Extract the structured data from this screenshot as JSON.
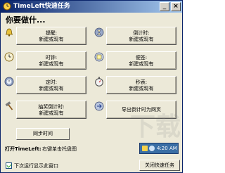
{
  "window": {
    "title": "TimeLeft快速任务",
    "minimize_label": "_",
    "close_label": "×"
  },
  "question": "你要做什...",
  "tasks": [
    {
      "line1": "提醒:",
      "line2": "新建或现有",
      "icon": "bell-icon"
    },
    {
      "line1": "倒计时:",
      "line2": "新建或现有",
      "icon": "hourglass-icon"
    },
    {
      "line1": "时钟:",
      "line2": "新建或现有",
      "icon": "clock-icon"
    },
    {
      "line1": "便签:",
      "line2": "新建或现有",
      "icon": "sticky-note-icon"
    },
    {
      "line1": "定时:",
      "line2": "新建或现有",
      "icon": "timer-icon"
    },
    {
      "line1": "秒表:",
      "line2": "新建或现有",
      "icon": "stopwatch-icon"
    },
    {
      "line1": "抽奖倒计时:",
      "line2": "新建或现有",
      "icon": "hammer-icon"
    },
    {
      "line1": "导出倒计时为网页",
      "line2": "",
      "icon": "export-web-icon"
    }
  ],
  "sync_button": "同步时间",
  "open_label": "打开TimeLeft:",
  "open_text": "右键单击托盘图",
  "tray_time": "4:20 AM",
  "show_on_startup": "下次运行显示此窗口",
  "close_button": "关闭快速任务",
  "watermark": "下载"
}
